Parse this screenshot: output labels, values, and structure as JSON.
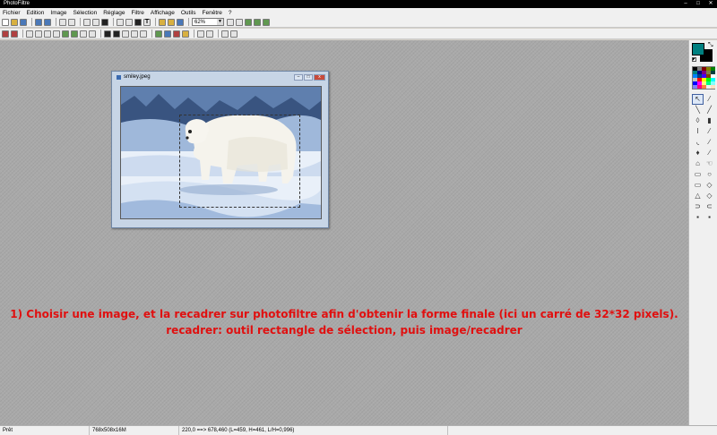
{
  "app": {
    "title": "PhotoFiltre",
    "window_buttons": [
      "–",
      "□",
      "✕"
    ]
  },
  "menu": [
    "Fichier",
    "Edition",
    "Image",
    "Sélection",
    "Réglage",
    "Filtre",
    "Affichage",
    "Outils",
    "Fenêtre",
    "?"
  ],
  "toolbar": {
    "zoom_value": "62%",
    "zoom_arrow": "▼",
    "text_tool_glyph": "T"
  },
  "document": {
    "filename": "smiley.jpeg",
    "buttons": [
      "–",
      "□",
      "x"
    ]
  },
  "instructions": {
    "line1": "1) Choisir une image, et la recadrer sur photofiltre afin d'obtenir la forme finale (ici un carré de 32*32 pixels).",
    "line2": "recadrer: outil rectangle de sélection, puis image/recadrer"
  },
  "colors": {
    "foreground": "#008080",
    "background": "#000000",
    "instruction_text": "#e01010",
    "palette": [
      "#000000",
      "#808080",
      "#800000",
      "#808000",
      "#008000",
      "#008080",
      "#000080",
      "#800080",
      "#808040",
      "#004040",
      "#0080ff",
      "#004080",
      "#4000ff",
      "#804000",
      "#ffffff",
      "#c0c0c0",
      "#ff0000",
      "#ffff00",
      "#00ff00",
      "#00ffff",
      "#0000ff",
      "#ff00ff",
      "#ffff80",
      "#00ff80",
      "#80ffff",
      "#8080ff",
      "#ff0080",
      "#ff8040",
      "#f0f0f0",
      "#ffe0c0"
    ]
  },
  "tool_icons": [
    "↖",
    "⁄",
    "╲",
    "╱",
    "◊",
    "▮",
    "ǀ",
    "⁄",
    "◟",
    "∕",
    "♦",
    "∕",
    "⌂",
    "☜",
    "▭",
    "○",
    "▭",
    "◇",
    "△",
    "◇",
    "⊃",
    "⊂",
    "▪",
    "▪"
  ],
  "status": {
    "state": "Prêt",
    "dimensions": "768x508x16M",
    "coords": "220,0 ==> 678,460 (L=459, H=461, L/H=0,996)"
  }
}
